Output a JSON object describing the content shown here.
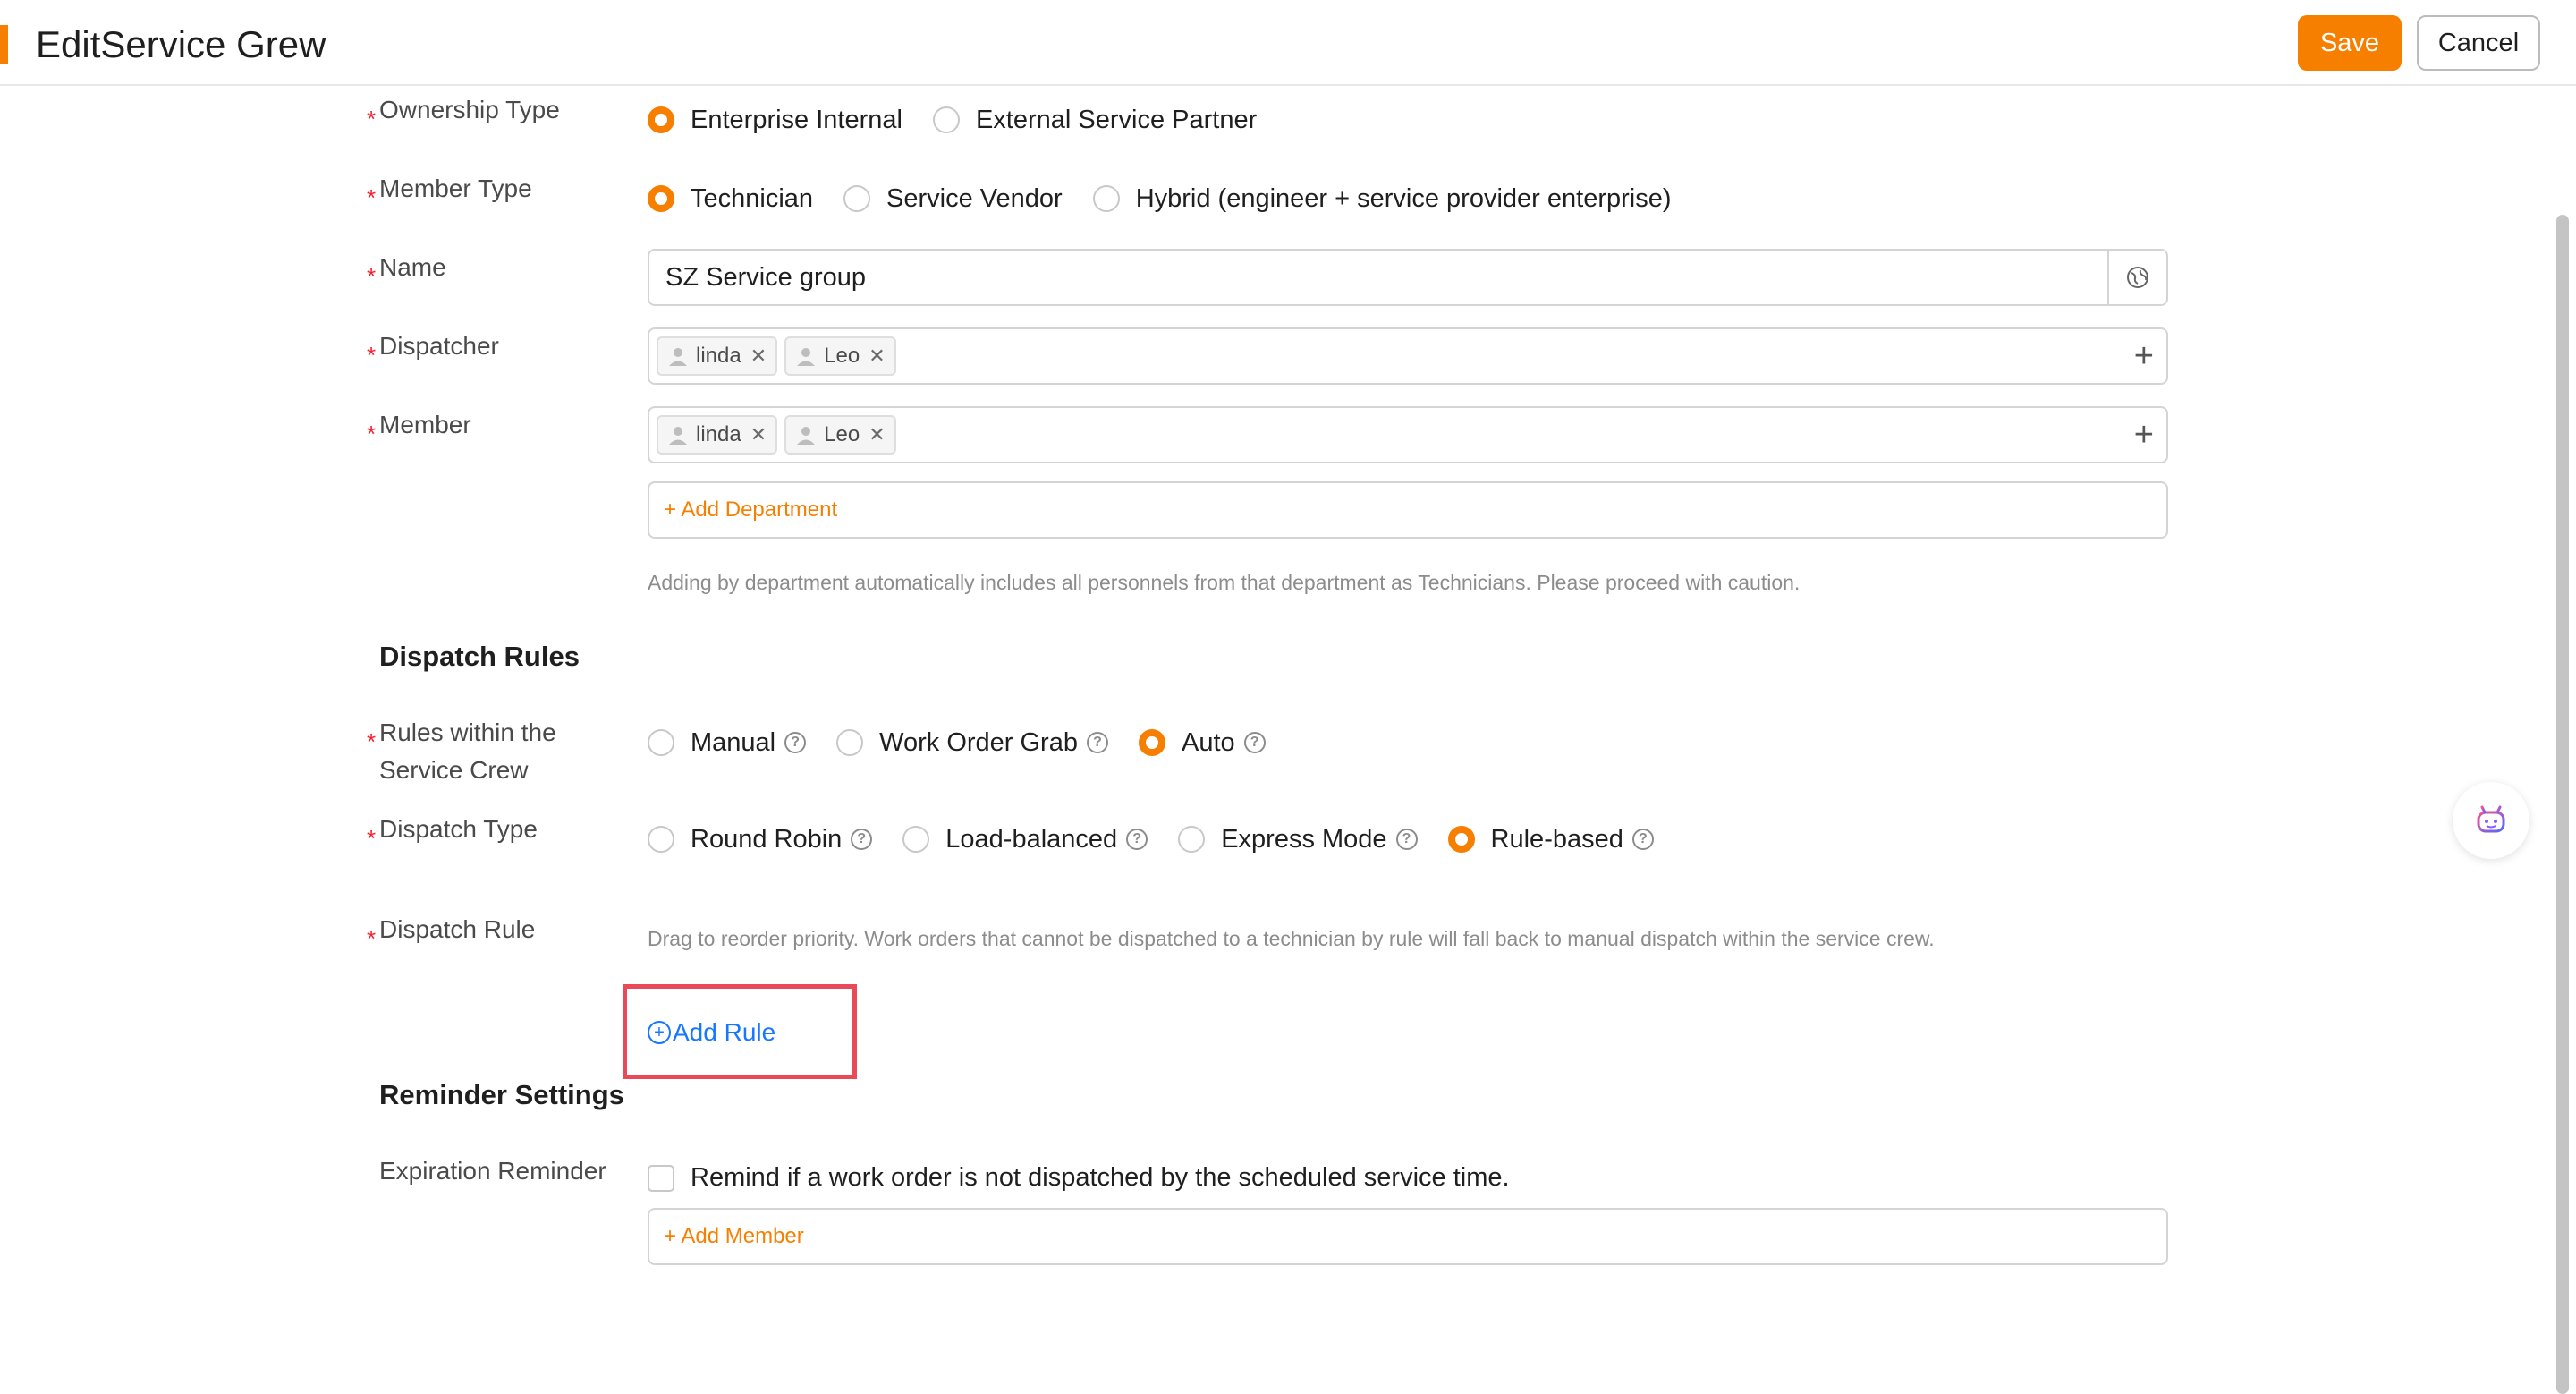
{
  "header": {
    "title": "EditService Grew",
    "save_label": "Save",
    "cancel_label": "Cancel"
  },
  "form": {
    "ownership_type": {
      "label": "Ownership Type",
      "options": [
        "Enterprise Internal",
        "External Service Partner"
      ],
      "selected": "Enterprise Internal"
    },
    "member_type": {
      "label": "Member Type",
      "options": [
        "Technician",
        "Service Vendor",
        "Hybrid (engineer + service provider enterprise)"
      ],
      "selected": "Technician"
    },
    "name": {
      "label": "Name",
      "value": "SZ Service group"
    },
    "dispatcher": {
      "label": "Dispatcher",
      "tags": [
        "linda",
        "Leo"
      ]
    },
    "member": {
      "label": "Member",
      "tags": [
        "linda",
        "Leo"
      ],
      "add_department": "+ Add Department",
      "hint": "Adding by department automatically includes all personnels from that department as Technicians. Please proceed with caution."
    }
  },
  "dispatch_rules": {
    "title": "Dispatch Rules",
    "rules_within": {
      "label_line1": "Rules within the",
      "label_line2": "Service Crew",
      "options": [
        "Manual",
        "Work Order Grab",
        "Auto"
      ],
      "selected": "Auto"
    },
    "dispatch_type": {
      "label": "Dispatch Type",
      "options": [
        "Round Robin",
        "Load-balanced",
        "Express Mode",
        "Rule-based"
      ],
      "selected": "Rule-based"
    },
    "dispatch_rule": {
      "label": "Dispatch Rule",
      "hint": "Drag to reorder priority. Work orders that cannot be dispatched to a technician by rule will fall back to manual dispatch within the service crew.",
      "add_rule": "Add Rule"
    }
  },
  "reminder": {
    "title": "Reminder Settings",
    "expiration": {
      "label": "Expiration Reminder",
      "checkbox_text": "Remind if a work order is not dispatched by the scheduled service time.",
      "add_member": "+ Add Member"
    }
  },
  "colors": {
    "accent": "#f77f00",
    "link": "#1677ff",
    "required": "#f5222d",
    "highlight": "#e84a5a"
  }
}
